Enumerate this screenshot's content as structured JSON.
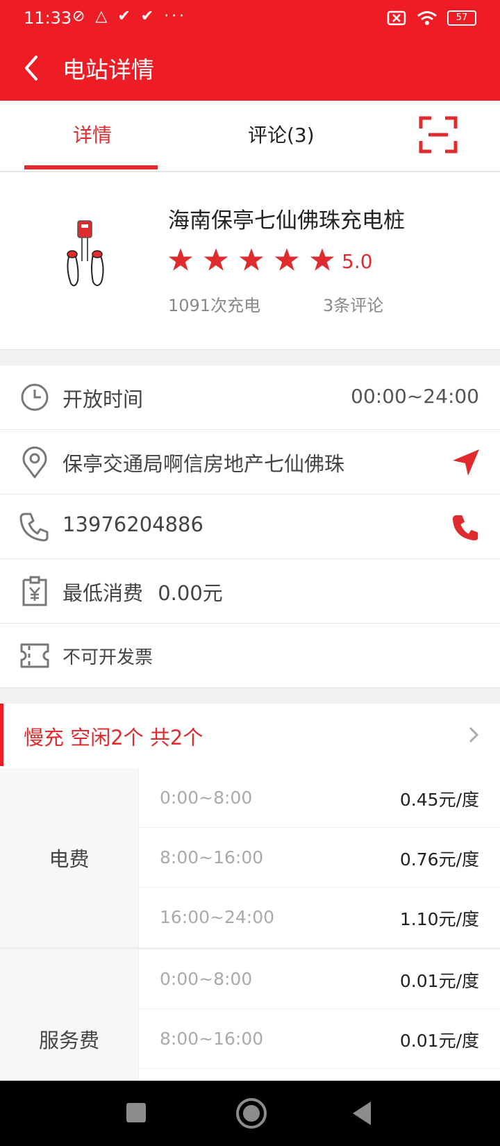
{
  "status_bar": {
    "time": "11:33",
    "left_icons": "⊘ △ ✔ ✔ ···",
    "battery": "57"
  },
  "app_bar": {
    "title": "电站详情"
  },
  "tabs": [
    {
      "label": "详情",
      "active": true
    },
    {
      "label": "评论(3)",
      "active": false
    }
  ],
  "station": {
    "name": "海南保亭七仙佛珠充电桩",
    "rating": "5.0",
    "stars": 5,
    "charge_count": "1091次充电",
    "review_count": "3条评论"
  },
  "info": {
    "open_label": "开放时间",
    "open_hours": "00:00~24:00",
    "address": "保亭交通局啊信房地产七仙佛珠",
    "phone": "13976204886",
    "min_label": "最低消费",
    "min_value": "0.00元",
    "invoice": "不可开发票"
  },
  "slow_charge": {
    "text": "慢充 空闲2个 共2个"
  },
  "fees": [
    {
      "label": "电费",
      "rows": [
        {
          "time": "0:00~8:00",
          "price": "0.45元/度"
        },
        {
          "time": "8:00~16:00",
          "price": "0.76元/度"
        },
        {
          "time": "16:00~24:00",
          "price": "1.10元/度"
        }
      ]
    },
    {
      "label": "服务费",
      "rows": [
        {
          "time": "0:00~8:00",
          "price": "0.01元/度"
        },
        {
          "time": "8:00~16:00",
          "price": "0.01元/度"
        }
      ]
    }
  ],
  "colors": {
    "brand_red": "#ee1c25",
    "accent_red": "#e02b2e"
  }
}
